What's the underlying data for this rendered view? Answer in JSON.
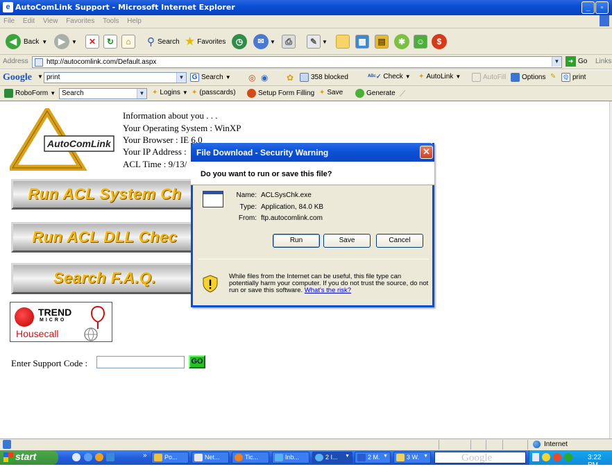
{
  "window": {
    "title": "AutoComLink Support - Microsoft Internet Explorer",
    "minimize": "_",
    "maximize": "▫"
  },
  "menu": [
    "File",
    "Edit",
    "View",
    "Favorites",
    "Tools",
    "Help"
  ],
  "toolbar": {
    "back_label": "Back",
    "search_label": "Search",
    "favorites_label": "Favorites"
  },
  "address": {
    "label": "Address",
    "url": "http://autocomlink.com/Default.aspx",
    "go_label": "Go",
    "links_label": "Links"
  },
  "google_toolbar": {
    "brand": "Google",
    "search_value": "print",
    "search_button": "Search",
    "blocked": "358 blocked",
    "check": "Check",
    "autolink": "AutoLink",
    "autofill": "AutoFill",
    "options": "Options",
    "print_label": "print"
  },
  "roboform": {
    "brand": "RoboForm",
    "search_value": "Search",
    "logins": "Logins",
    "passcards": "(passcards)",
    "setup": "Setup Form Filling",
    "save": "Save",
    "generate": "Generate"
  },
  "page": {
    "logo_text": "AutoComLink",
    "info": [
      "Information about you . . .",
      "Your Operating System : WinXP",
      "Your Browser : IE 6.0",
      "Your IP Address :",
      "ACL Time : 9/13/"
    ],
    "buttons": [
      "Run ACL System Ch",
      "Run ACL DLL Chec",
      "Search F.A.Q."
    ],
    "trend_brand": "TREND",
    "trend_sub": "MICRO",
    "housecall": "Housecall",
    "support_label": "Enter Support Code :",
    "support_value": "",
    "go_button": "GO"
  },
  "dialog": {
    "title": "File Download - Security Warning",
    "question": "Do you want to run or save this file?",
    "name_label": "Name:",
    "name_value": "ACLSysChk.exe",
    "type_label": "Type:",
    "type_value": "Application, 84.0 KB",
    "from_label": "From:",
    "from_value": "ftp.autocomlink.com",
    "run_button": "Run",
    "save_button": "Save",
    "cancel_button": "Cancel",
    "warning_text": "While files from the Internet can be useful, this file type can potentially harm your computer. If you do not trust the source, do not run or save this software.",
    "risk_link": "What's the risk?"
  },
  "status": {
    "zone": "Internet"
  },
  "taskbar": {
    "start_label": "start",
    "tasks": [
      "Po...",
      "Net...",
      "Tic...",
      "Inb...",
      "2 I...",
      "2 M.",
      "3 W."
    ],
    "search_brand": "Google",
    "clock": "3:22 PM"
  }
}
